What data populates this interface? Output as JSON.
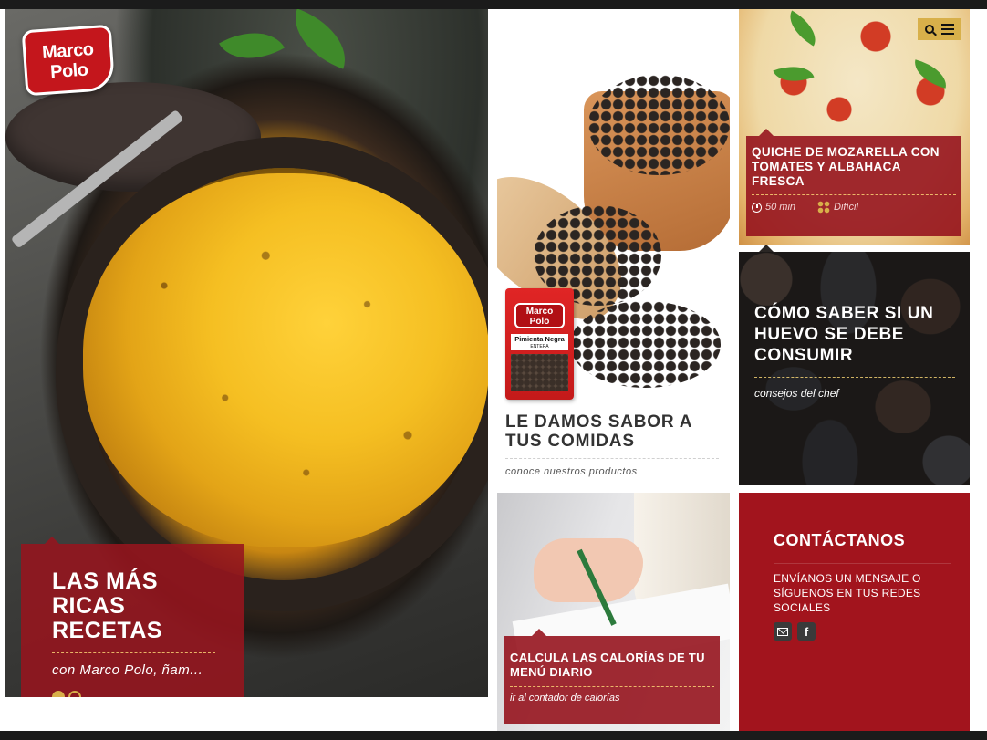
{
  "brand": {
    "logo_line1": "Marco",
    "logo_line2": "Polo"
  },
  "hero": {
    "title": "LAS MÁS RICAS RECETAS",
    "subtitle": "con Marco Polo, ñam...",
    "slides": 2,
    "active_slide": 1
  },
  "product": {
    "pack_line1": "Marco",
    "pack_line2": "Polo",
    "pack_label": "Pimienta Negra",
    "pack_sublabel": "ENTERA",
    "title": "LE DAMOS SABOR A TUS COMIDAS",
    "subtitle": "conoce nuestros productos"
  },
  "quiche": {
    "title": "QUICHE DE MOZARELLA CON TOMATES Y ALBAHACA FRESCA",
    "time": "50 min",
    "difficulty": "Difícil"
  },
  "header_tools": {
    "search_icon": "search-icon",
    "menu_icon": "menu-icon"
  },
  "eggs": {
    "title": "CÓMO SABER SI UN HUEVO SE DEBE CONSUMIR",
    "subtitle": "consejos del chef"
  },
  "calories": {
    "title": "CALCULA LAS CALORÍAS DE TU MENÚ DIARIO",
    "subtitle": "ir al contador de calorías"
  },
  "contact": {
    "title": "CONTÁCTANOS",
    "text": "ENVÍANOS UN MENSAJE O SÍGUENOS EN TUS REDES SOCIALES",
    "facebook_glyph": "f"
  },
  "colors": {
    "accent": "#a2141d",
    "gold": "#d8b04a"
  }
}
